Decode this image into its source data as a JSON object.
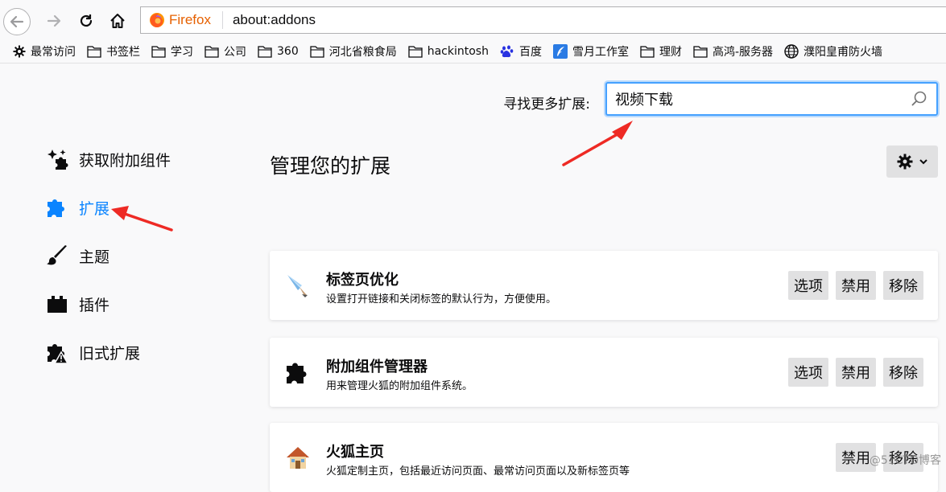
{
  "browser": {
    "brand": "Firefox",
    "url": "about:addons"
  },
  "bookmarks": [
    {
      "label": "最常访问",
      "icon": "gear-icon"
    },
    {
      "label": "书签栏",
      "icon": "folder-icon"
    },
    {
      "label": "学习",
      "icon": "folder-icon"
    },
    {
      "label": "公司",
      "icon": "folder-icon"
    },
    {
      "label": "360",
      "icon": "folder-icon"
    },
    {
      "label": "河北省粮食局",
      "icon": "folder-icon"
    },
    {
      "label": "hackintosh",
      "icon": "folder-icon"
    },
    {
      "label": "百度",
      "icon": "baidu-paw-icon"
    },
    {
      "label": "雪月工作室",
      "icon": "feather-icon"
    },
    {
      "label": "理财",
      "icon": "folder-icon"
    },
    {
      "label": "高鸿-服务器",
      "icon": "folder-icon"
    },
    {
      "label": "濮阳皇甫防火墙",
      "icon": "globe-icon"
    }
  ],
  "search": {
    "label": "寻找更多扩展:",
    "value": "视频下载"
  },
  "sidebar": {
    "items": [
      {
        "label": "获取附加组件",
        "icon": "sparkle-puzzle-icon",
        "active": false
      },
      {
        "label": "扩展",
        "icon": "puzzle-icon",
        "active": true
      },
      {
        "label": "主题",
        "icon": "brush-icon",
        "active": false
      },
      {
        "label": "插件",
        "icon": "plugin-block-icon",
        "active": false
      },
      {
        "label": "旧式扩展",
        "icon": "legacy-puzzle-icon",
        "active": false
      }
    ]
  },
  "main": {
    "title": "管理您的扩展",
    "extensions": [
      {
        "name": "标签页优化",
        "description": "设置打开链接和关闭标签的默认行为，方便使用。",
        "icon": "quill-icon",
        "buttons": {
          "options": "选项",
          "disable": "禁用",
          "remove": "移除"
        }
      },
      {
        "name": "附加组件管理器",
        "description": "用来管理火狐的附加组件系统。",
        "icon": "puzzle-icon",
        "buttons": {
          "options": "选项",
          "disable": "禁用",
          "remove": "移除"
        }
      },
      {
        "name": "火狐主页",
        "description": "火狐定制主页，包括最近访问页面、最常访问页面以及新标签页等",
        "icon": "house-icon",
        "buttons": {
          "disable": "禁用",
          "remove": "移除"
        }
      }
    ]
  },
  "watermark": "@51CTO博客",
  "colors": {
    "accent": "#0a84ff",
    "annotation": "#ee2a24",
    "firefox": "#e66000"
  }
}
